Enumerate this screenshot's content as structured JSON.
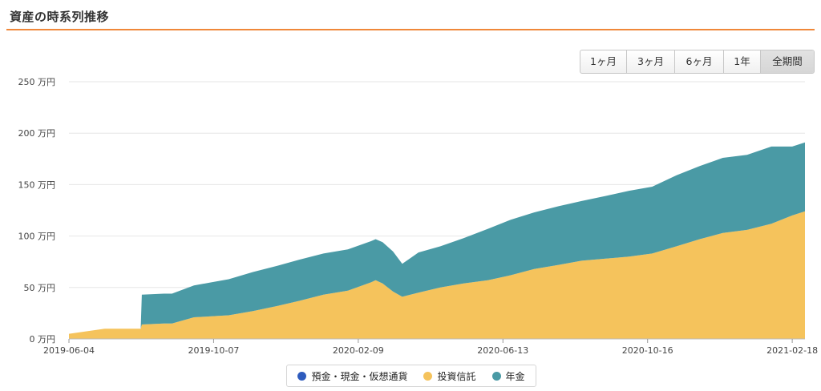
{
  "page": {
    "title": "資産の時系列推移"
  },
  "range_buttons": [
    {
      "label": "1ヶ月",
      "active": false
    },
    {
      "label": "3ヶ月",
      "active": false
    },
    {
      "label": "6ヶ月",
      "active": false
    },
    {
      "label": "1年",
      "active": false
    },
    {
      "label": "全期間",
      "active": true
    }
  ],
  "colors": {
    "accent": "#f0883a",
    "grid": "#e6e6e6"
  },
  "chart_data": {
    "type": "area",
    "stacked": true,
    "xlabel": "",
    "ylabel": "",
    "y_unit": "万円",
    "ylim": [
      0,
      250
    ],
    "y_ticks": [
      0,
      50,
      100,
      150,
      200,
      250
    ],
    "y_tick_labels": [
      "0 万円",
      "50 万円",
      "100 万円",
      "150 万円",
      "200 万円",
      "250 万円"
    ],
    "x_range": [
      "2019-06-04",
      "2021-03-01"
    ],
    "x_tick_labels": [
      "2019-06-04",
      "2019-10-07",
      "2020-02-09",
      "2020-06-13",
      "2020-10-16",
      "2021-02-18"
    ],
    "legend_position": "bottom-center",
    "grid": true,
    "x": [
      "2019-06-04",
      "2019-07-05",
      "2019-07-21",
      "2019-08-05",
      "2019-08-06",
      "2019-08-25",
      "2019-09-01",
      "2019-09-20",
      "2019-10-05",
      "2019-10-20",
      "2019-11-10",
      "2019-12-01",
      "2019-12-20",
      "2020-01-10",
      "2020-01-31",
      "2020-02-20",
      "2020-02-24",
      "2020-03-01",
      "2020-03-10",
      "2020-03-18",
      "2020-04-01",
      "2020-04-20",
      "2020-05-10",
      "2020-05-31",
      "2020-06-20",
      "2020-07-10",
      "2020-07-31",
      "2020-08-20",
      "2020-09-10",
      "2020-09-30",
      "2020-10-20",
      "2020-11-10",
      "2020-11-30",
      "2020-12-20",
      "2021-01-10",
      "2021-01-31",
      "2021-02-18",
      "2021-03-01"
    ],
    "series": [
      {
        "name": "預金・現金・仮想通貨",
        "color": "#2e5bbd",
        "values": [
          0,
          0,
          0,
          0,
          0,
          0,
          0,
          0,
          0,
          0,
          0,
          0,
          0,
          0,
          0,
          0,
          0,
          0,
          0,
          0,
          0,
          0,
          0,
          0,
          0,
          0,
          0,
          0,
          0,
          0,
          0,
          0,
          0,
          0,
          0,
          0,
          0,
          0
        ]
      },
      {
        "name": "投資信託",
        "color": "#f5c35c",
        "values": [
          5,
          10,
          10,
          10,
          14,
          15,
          15,
          21,
          22,
          23,
          27,
          32,
          37,
          43,
          47,
          55,
          57,
          54,
          46,
          41,
          45,
          50,
          54,
          57,
          62,
          68,
          72,
          76,
          78,
          80,
          83,
          90,
          97,
          103,
          106,
          112,
          120,
          124
        ]
      },
      {
        "name": "年金",
        "color": "#4a9aa5",
        "values": [
          0,
          0,
          0,
          0,
          29,
          29,
          29,
          31,
          33,
          35,
          38,
          39,
          40,
          40,
          40,
          40,
          40,
          40,
          39,
          32,
          39,
          40,
          44,
          50,
          54,
          55,
          57,
          58,
          61,
          64,
          65,
          69,
          71,
          73,
          73,
          75,
          67,
          67
        ]
      }
    ]
  }
}
